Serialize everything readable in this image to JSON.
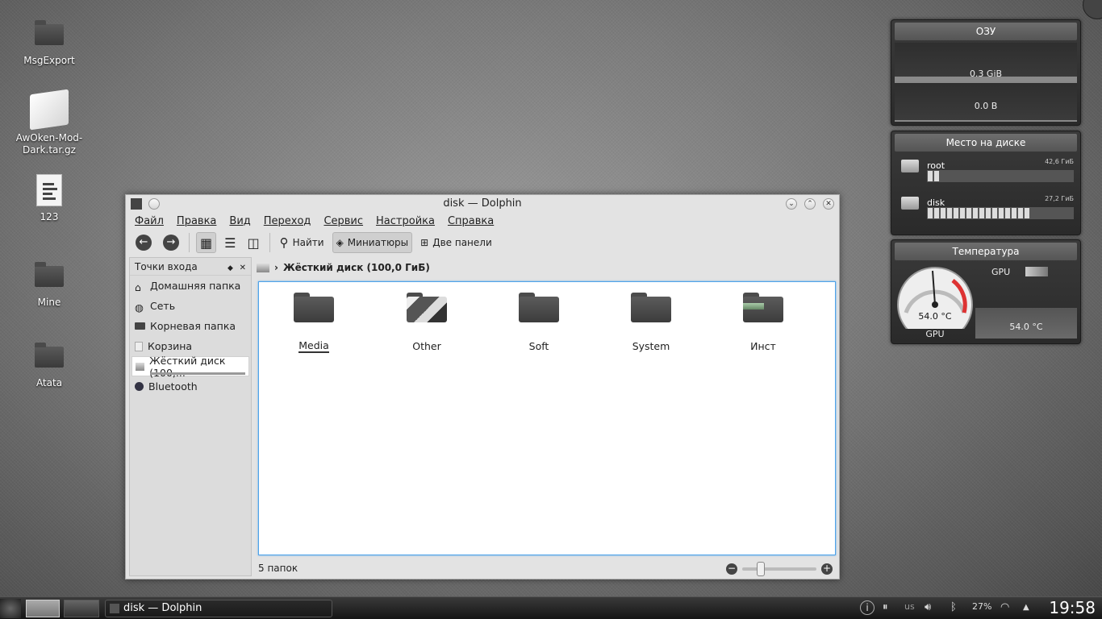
{
  "desktop": {
    "icons": [
      {
        "label": "MsgExport",
        "type": "folder"
      },
      {
        "label": "AwOken-Mod-Dark.tar.gz",
        "type": "archive"
      },
      {
        "label": "123",
        "type": "document"
      },
      {
        "label": "Mine",
        "type": "folder"
      },
      {
        "label": "Atata",
        "type": "folder"
      }
    ]
  },
  "widgets": {
    "ram": {
      "title": "ОЗУ",
      "used": "0.3 GiB",
      "swap": "0.0 B"
    },
    "disk_space": {
      "title": "Место на диске",
      "disks": [
        {
          "name": "root",
          "size": "42,6 ГиБ",
          "fill": 0.08
        },
        {
          "name": "disk",
          "size": "27,2 ГиБ",
          "fill": 0.72
        }
      ]
    },
    "temperature": {
      "title": "Температура",
      "gauge_value": "54.0 °C",
      "gauge_label": "GPU",
      "legend": "GPU",
      "graph_value": "54.0 °C"
    }
  },
  "window": {
    "title": "disk — Dolphin",
    "menu": [
      "Файл",
      "Правка",
      "Вид",
      "Переход",
      "Сервис",
      "Настройка",
      "Справка"
    ],
    "toolbar": {
      "find": "Найти",
      "thumbnails": "Миниатюры",
      "split": "Две панели"
    },
    "places": {
      "title": "Точки входа",
      "items": [
        {
          "label": "Домашняя папка",
          "icon": "home-icon"
        },
        {
          "label": "Сеть",
          "icon": "network-icon"
        },
        {
          "label": "Корневая папка",
          "icon": "folder-icon"
        },
        {
          "label": "Корзина",
          "icon": "trash-icon"
        },
        {
          "label": "Жёсткий диск (100,...",
          "icon": "hdd-icon",
          "selected": true
        },
        {
          "label": "Bluetooth",
          "icon": "bluetooth-icon"
        }
      ]
    },
    "breadcrumb": "Жёсткий диск (100,0 ГиБ)",
    "files": [
      "Media",
      "Other",
      "Soft",
      "System",
      "Инст"
    ],
    "status": "5 папок"
  },
  "taskbar": {
    "task": "disk — Dolphin",
    "layout": "us",
    "battery": "27%",
    "clock": "19:58"
  }
}
